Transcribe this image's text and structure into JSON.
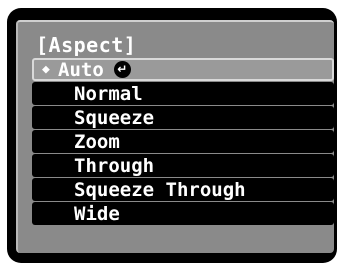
{
  "menu": {
    "title": "[Aspect]",
    "items": [
      {
        "label": "Auto",
        "selected": true
      },
      {
        "label": "Normal"
      },
      {
        "label": "Squeeze"
      },
      {
        "label": "Zoom"
      },
      {
        "label": "Through"
      },
      {
        "label": "Squeeze Through"
      },
      {
        "label": "Wide"
      }
    ]
  }
}
